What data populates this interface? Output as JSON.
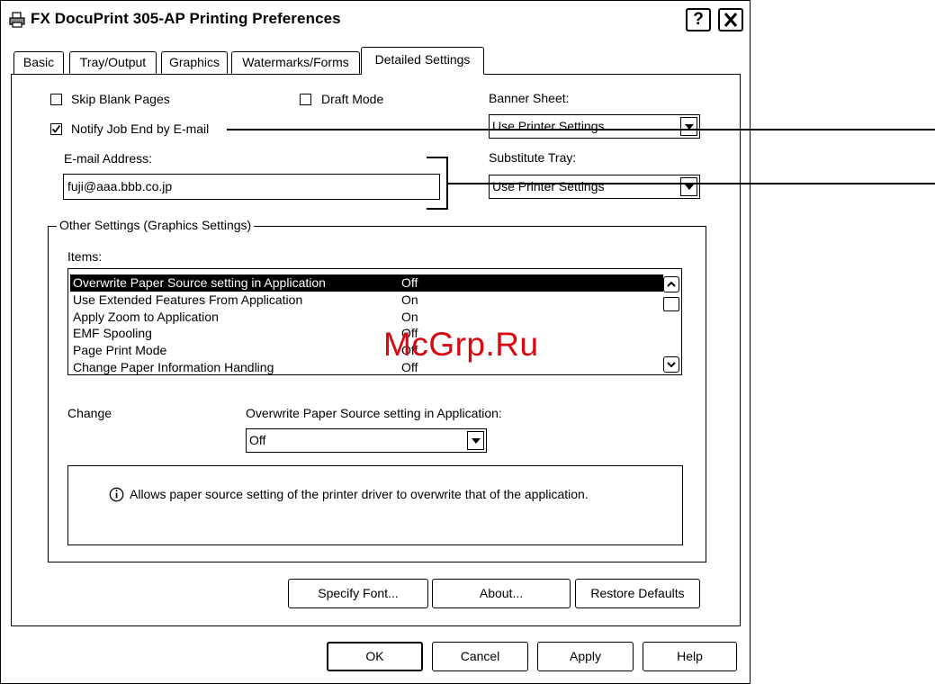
{
  "window": {
    "title": "FX DocuPrint 305-AP Printing Preferences",
    "help_button": "?",
    "close_button": "✕"
  },
  "tabs": [
    {
      "label": "Basic"
    },
    {
      "label": "Tray/Output"
    },
    {
      "label": "Graphics"
    },
    {
      "label": "Watermarks/Forms"
    },
    {
      "label": "Detailed Settings",
      "active": true
    }
  ],
  "options": {
    "skip_blank_pages": {
      "label": "Skip Blank Pages",
      "checked": false
    },
    "draft_mode": {
      "label": "Draft Mode",
      "checked": false
    },
    "notify_job_end": {
      "label": "Notify Job End by E-mail",
      "checked": true
    },
    "email_label": "E-mail Address:",
    "email_value": "fuji@aaa.bbb.co.jp",
    "banner_sheet_label": "Banner Sheet:",
    "banner_sheet_value": "Use Printer Settings",
    "substitute_tray_label": "Substitute Tray:",
    "substitute_tray_value": "Use Printer Settings"
  },
  "other_settings": {
    "group_label": "Other Settings (Graphics Settings)",
    "items_label": "Items:",
    "items": [
      {
        "name": "Overwrite Paper Source setting in Application",
        "value": "Off",
        "selected": true
      },
      {
        "name": "Use Extended Features From Application",
        "value": "On"
      },
      {
        "name": "Apply Zoom to Application",
        "value": "On"
      },
      {
        "name": "EMF Spooling",
        "value": "Off"
      },
      {
        "name": "Page Print Mode",
        "value": "Off"
      },
      {
        "name": "Change Paper Information Handling",
        "value": "Off"
      }
    ],
    "change_label": "Change",
    "setting_label": "Overwrite Paper Source setting in Application:",
    "setting_value": "Off",
    "info_icon": "info-icon",
    "info_text": "Allows paper source setting of the printer driver to overwrite that of the application."
  },
  "panel_buttons": {
    "specify_font": "Specify Font...",
    "about": "About...",
    "restore_defaults": "Restore Defaults"
  },
  "dialog_buttons": {
    "ok": "OK",
    "cancel": "Cancel",
    "apply": "Apply",
    "help": "Help"
  },
  "watermark": "McGrp.Ru"
}
